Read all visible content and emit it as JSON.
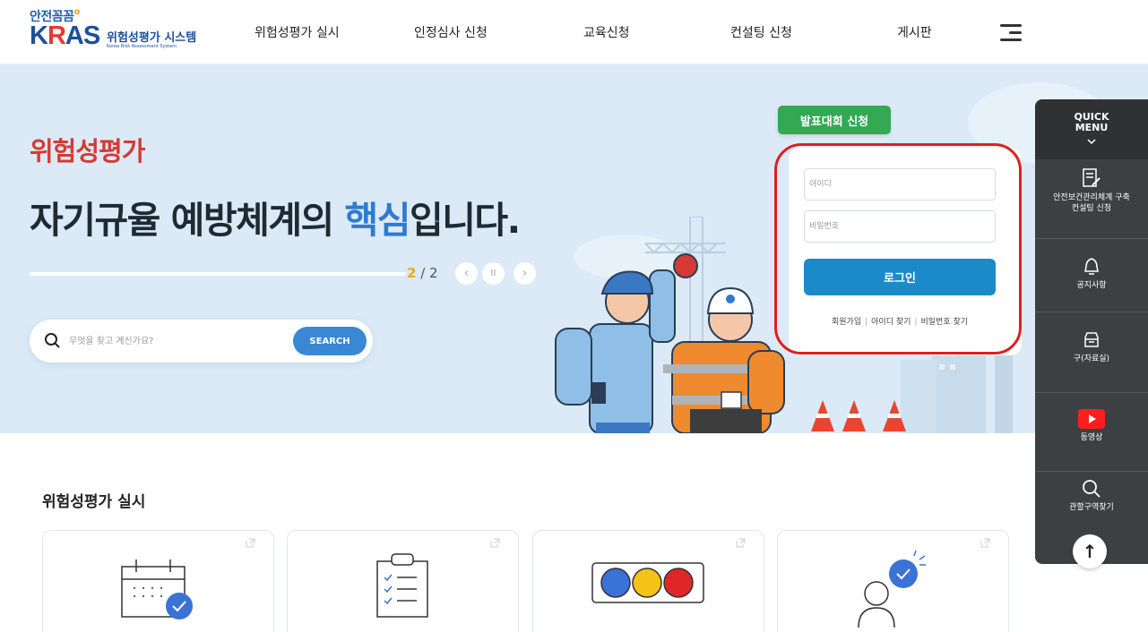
{
  "logo": {
    "top": "안전꼼꼼",
    "main_k": "K",
    "main_r": "R",
    "main_rest": "AS",
    "system": "위험성평가 시스템",
    "english": "Korea Risk Assessment System"
  },
  "nav": {
    "items": [
      {
        "label": "위험성평가 실시"
      },
      {
        "label": "인정심사 신청"
      },
      {
        "label": "교육신청"
      },
      {
        "label": "컨설팅 신청"
      },
      {
        "label": "게시판"
      }
    ]
  },
  "hero": {
    "subtitle": "위험성평가",
    "title_before": "자기규율 예방체계의 ",
    "title_highlight": "핵심",
    "title_after": "입니다.",
    "slide_current": "2",
    "slide_sep": " / ",
    "slide_total": "2",
    "slide_progress": 1.0,
    "prev_icon": "‹",
    "pause_icon": "II",
    "next_icon": "›"
  },
  "search": {
    "placeholder": "무엇을 찾고 계신가요?",
    "button_label": "SEARCH"
  },
  "presentation": {
    "label": "발표대회 신청"
  },
  "login": {
    "id_placeholder": "아이디",
    "pw_placeholder": "비밀번호",
    "button_label": "로그인",
    "signup": "회원가입",
    "find_id": "아이디 찾기",
    "find_pw": "비밀번호 찾기",
    "sep": "|"
  },
  "quick_menu": {
    "title_line1": "QUICK",
    "title_line2": "MENU",
    "items": [
      {
        "label_line1": "안전보건관리체계 구축",
        "label_line2": "컨설팅 신청",
        "icon": "document-edit-icon"
      },
      {
        "label_line1": "공지사항",
        "icon": "bell-icon"
      },
      {
        "label_line1": "구(자료실)",
        "icon": "archive-icon"
      },
      {
        "label_line1": "동영상",
        "icon": "youtube-icon"
      },
      {
        "label_line1": "관할구역찾기",
        "icon": "search-icon"
      }
    ],
    "top_label": "↑"
  },
  "section": {
    "title": "위험성평가 실시"
  },
  "colors": {
    "accent_blue": "#3a87d6",
    "login_blue": "#1a8ac9",
    "green": "#34a853",
    "red_highlight": "#e01e1e",
    "hero_bg": "#dbeaf6",
    "quick_bg": "#3d4043"
  }
}
